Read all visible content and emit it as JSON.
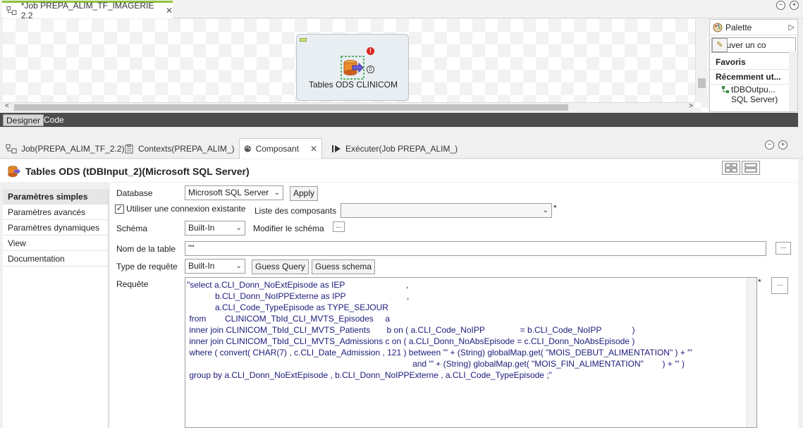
{
  "editor_tab": {
    "title": "*Job PREPA_ALIM_TF_IMAGERIE 2.2",
    "close": "✕"
  },
  "window_buttons": {
    "minimize": "−",
    "maximize": "+"
  },
  "canvas": {
    "component_label": "Tables ODS CLINICOM",
    "error_mark": "!",
    "connector_mark": "0"
  },
  "palette": {
    "title": "Palette",
    "search_placeholder": "Trouver un co",
    "section_favorites": "Favoris",
    "section_recent": "Récemment ut...",
    "recent_item_line1": "tDBOutpu...",
    "recent_item_line2": "SQL Server)"
  },
  "designer_tabs": [
    {
      "label": "Designer"
    },
    {
      "label": "Code"
    }
  ],
  "view_tabs": [
    {
      "label": "Job(PREPA_ALIM_TF_2.2)"
    },
    {
      "label": "Contexts(PREPA_ALIM_)"
    },
    {
      "label": "Composant",
      "close": "✕"
    },
    {
      "label": "Exécuter(Job PREPA_ALIM_)"
    }
  ],
  "component_title": "Tables ODS (tDBInput_2)(Microsoft SQL Server)",
  "nav": [
    {
      "label": "Paramètres simples"
    },
    {
      "label": "Paramètres avancés"
    },
    {
      "label": "Paramètres dynamiques"
    },
    {
      "label": "View"
    },
    {
      "label": "Documentation"
    }
  ],
  "settings": {
    "database_label": "Database",
    "database_value": "Microsoft SQL Server",
    "apply_label": "Apply",
    "use_connection_label": "Utiliser une connexion existante",
    "use_connection_checked": "✓",
    "component_list_label": "Liste des composants",
    "component_list_value": "",
    "required_mark": "*",
    "schema_label": "Schéma",
    "schema_value": "Built-In",
    "edit_schema_label": "Modifier le schéma",
    "dots": "...",
    "table_name_label": "Nom de la table",
    "table_name_value": "\"\"",
    "query_type_label": "Type de requête",
    "query_type_value": "Built-In",
    "guess_query_label": "Guess Query",
    "guess_schema_label": "Guess schema",
    "query_label": "Requête",
    "query_text": "\"select a.CLI_Donn_NoExtEpisode as IEP                          ,\n            b.CLI_Donn_NoIPPExterne as IPP                          ,\n            a.CLI_Code_TypeEpisode as TYPE_SEJOUR\n from        CLINICOM_TbId_CLI_MVTS_Episodes     a\n inner join CLINICOM_TbId_CLI_MVTS_Patients       b on ( a.CLI_Code_NoIPP               = b.CLI_Code_NoIPP             )\n inner join CLINICOM_TbId_CLI_MVTS_Admissions c on ( a.CLI_Donn_NoAbsEpisode = c.CLI_Donn_NoAbsEpisode )\n where ( convert( CHAR(7) , c.CLI_Date_Admission , 121 ) between '\" + (String) globalMap.get( \"MOIS_DEBUT_ALIMENTATION\" ) + \"'\n                                                                                                and '\" + (String) globalMap.get( \"MOIS_FIN_ALIMENTATION\"        ) + \"' )\n group by a.CLI_Donn_NoExtEpisode , b.CLI_Donn_NoIPPExterne , a.CLI_Code_TypeEpisode ;\""
  },
  "colors": {
    "accent_green": "#8cc63f",
    "dark_bar": "#4c4c4c",
    "error_red": "#d9251c"
  }
}
